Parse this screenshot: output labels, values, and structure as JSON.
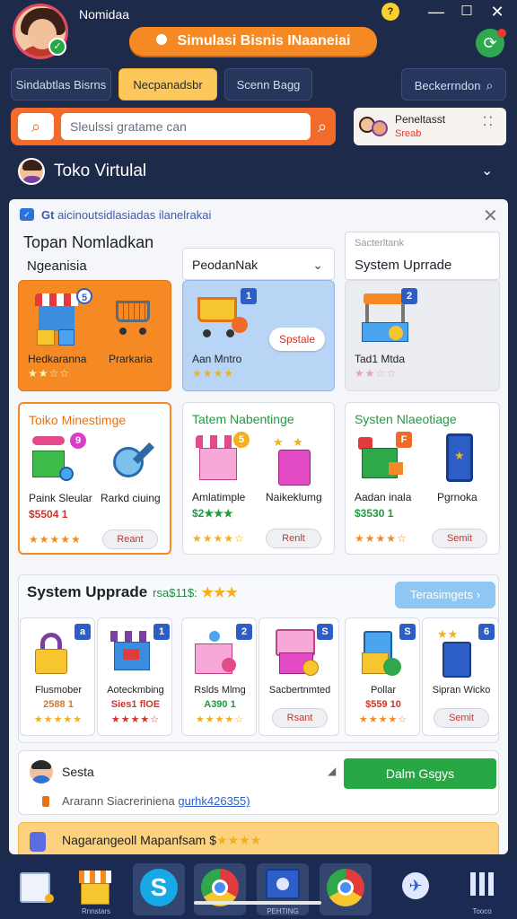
{
  "window": {
    "app_name": "Nomidaa",
    "title": "Simulasi Bisnis INaaneiai",
    "coin_symbol": "?",
    "minimize": "—",
    "maximize": "☐",
    "close": "✕",
    "sync_icon": "sync-icon"
  },
  "tabs": [
    {
      "label": "Sindabtlas Bisrns",
      "active": false
    },
    {
      "label": "Necpanadsbr",
      "active": true
    },
    {
      "label": "Scenn Bagg",
      "active": false
    },
    {
      "label": "Beckerrndon",
      "active": false,
      "icon": "search-icon"
    }
  ],
  "search": {
    "placeholder": "Sleulssi gratame can"
  },
  "profile": {
    "name": "Peneltasst",
    "subtitle": "Sreab"
  },
  "store": {
    "title": "Toko Virtulal"
  },
  "notice": {
    "prefix": "Gt",
    "text": "aicinoutsidlasiadas ilanelrakai"
  },
  "featured": {
    "heading": "Topan Nomladkan",
    "subheading": "Ngeanisia",
    "dropdown_label": "PeodanNak",
    "upgrade_small": "Sacterltank",
    "upgrade_title": "System Uprrade",
    "cards": [
      {
        "name_a": "Hedkaranna",
        "name_b": "Prarkaria",
        "badge": "5",
        "stars": "★★☆☆"
      },
      {
        "name_a": "Aan Mntro",
        "badge": "1",
        "button": "Spstale",
        "stars": "★★★★"
      },
      {
        "name_a": "Tad1 Mtda",
        "badge": "2",
        "stars": "★★☆☆"
      }
    ]
  },
  "categories": [
    {
      "title": "Toiko Minestimge",
      "badge": "9",
      "items": [
        {
          "name": "Paink Sleular",
          "price": "$5504 1"
        },
        {
          "name": "Rarkd ciuing",
          "price": ""
        }
      ],
      "stars": "★★★★★",
      "button": "Reant"
    },
    {
      "title": "Tatem Nabentinge",
      "badge": "5",
      "items": [
        {
          "name": "Amlatimple",
          "price": "$2★★★"
        },
        {
          "name": "Naikeklumg",
          "price": ""
        }
      ],
      "stars": "★★★★☆",
      "button": "Renlt"
    },
    {
      "title": "Systen Nlaeotiage",
      "badge": "F",
      "items": [
        {
          "name": "Aadan inala",
          "price": "$3530 1"
        },
        {
          "name": "Pgrnoka",
          "price": ""
        }
      ],
      "stars": "★★★★☆",
      "button": "Semit"
    }
  ],
  "upgrades": {
    "heading": "System Upprade",
    "tag": "rsa$11$:",
    "stars": "★★★",
    "link": "Terasimgets",
    "items": [
      {
        "name": "Flusmober",
        "price": "2588 1",
        "stars": "★★★★★",
        "badge": "a"
      },
      {
        "name": "Aoteckmbing",
        "price": "Sies1 flOE",
        "stars": "★★★★☆",
        "badge": "1"
      },
      {
        "name": "Rslds Mlmg",
        "price": "A390 1",
        "stars": "★★★★☆",
        "badge": "2",
        "button": ""
      },
      {
        "name": "Sacbertnmted",
        "price": "",
        "stars": "",
        "badge": "S",
        "button": "Rsant"
      },
      {
        "name": "Pollar",
        "price": "$559 10",
        "stars": "★★★★☆",
        "badge": "S"
      },
      {
        "name": "Sipran Wicko",
        "price": "",
        "stars": "",
        "badge": "6",
        "button": "Semit"
      }
    ]
  },
  "chat": {
    "name": "Sesta",
    "send_icon": "send-icon",
    "button": "Dalm Gsgys",
    "sub_text": "Ararann Siacreriniena",
    "sub_link": "gurhk426355)"
  },
  "promo": {
    "text": "Nagarangeoll Mapanfsam $",
    "stars": "★★★★"
  },
  "taskbar": {
    "items": [
      {
        "name": "apps-icon",
        "label": ""
      },
      {
        "name": "store-icon",
        "label": "Rnnstars"
      },
      {
        "name": "skype-icon",
        "label": ""
      },
      {
        "name": "chrome-icon",
        "label": ""
      },
      {
        "name": "media-icon",
        "label": "PEHTING"
      },
      {
        "name": "chrome-alt-icon",
        "label": ""
      },
      {
        "name": "network-icon",
        "label": ""
      },
      {
        "name": "grid-icon",
        "label": "Tooco"
      }
    ]
  },
  "colors": {
    "accent_orange": "#f58a24",
    "accent_blue": "#2d5ec6",
    "accent_green": "#27a844",
    "background_dark": "#1e2a4a"
  }
}
